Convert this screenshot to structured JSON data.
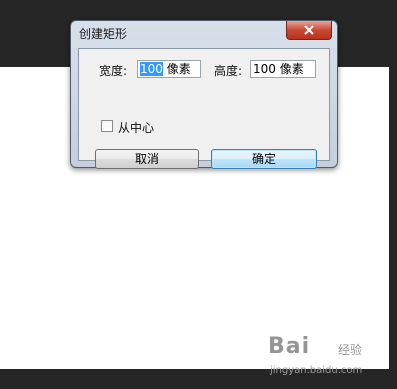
{
  "dialog": {
    "title": "创建矩形",
    "width_label": "宽度:",
    "width_value_selected": "100",
    "width_value_rest": " 像素",
    "height_label": "高度:",
    "height_value": "100 像素",
    "from_center_label": "从中心",
    "from_center_checked": false,
    "cancel_label": "取消",
    "ok_label": "确定"
  },
  "watermark": {
    "logo": "Bai",
    "logo_suffix": "经验",
    "url": "jingyan.baidu.com"
  }
}
